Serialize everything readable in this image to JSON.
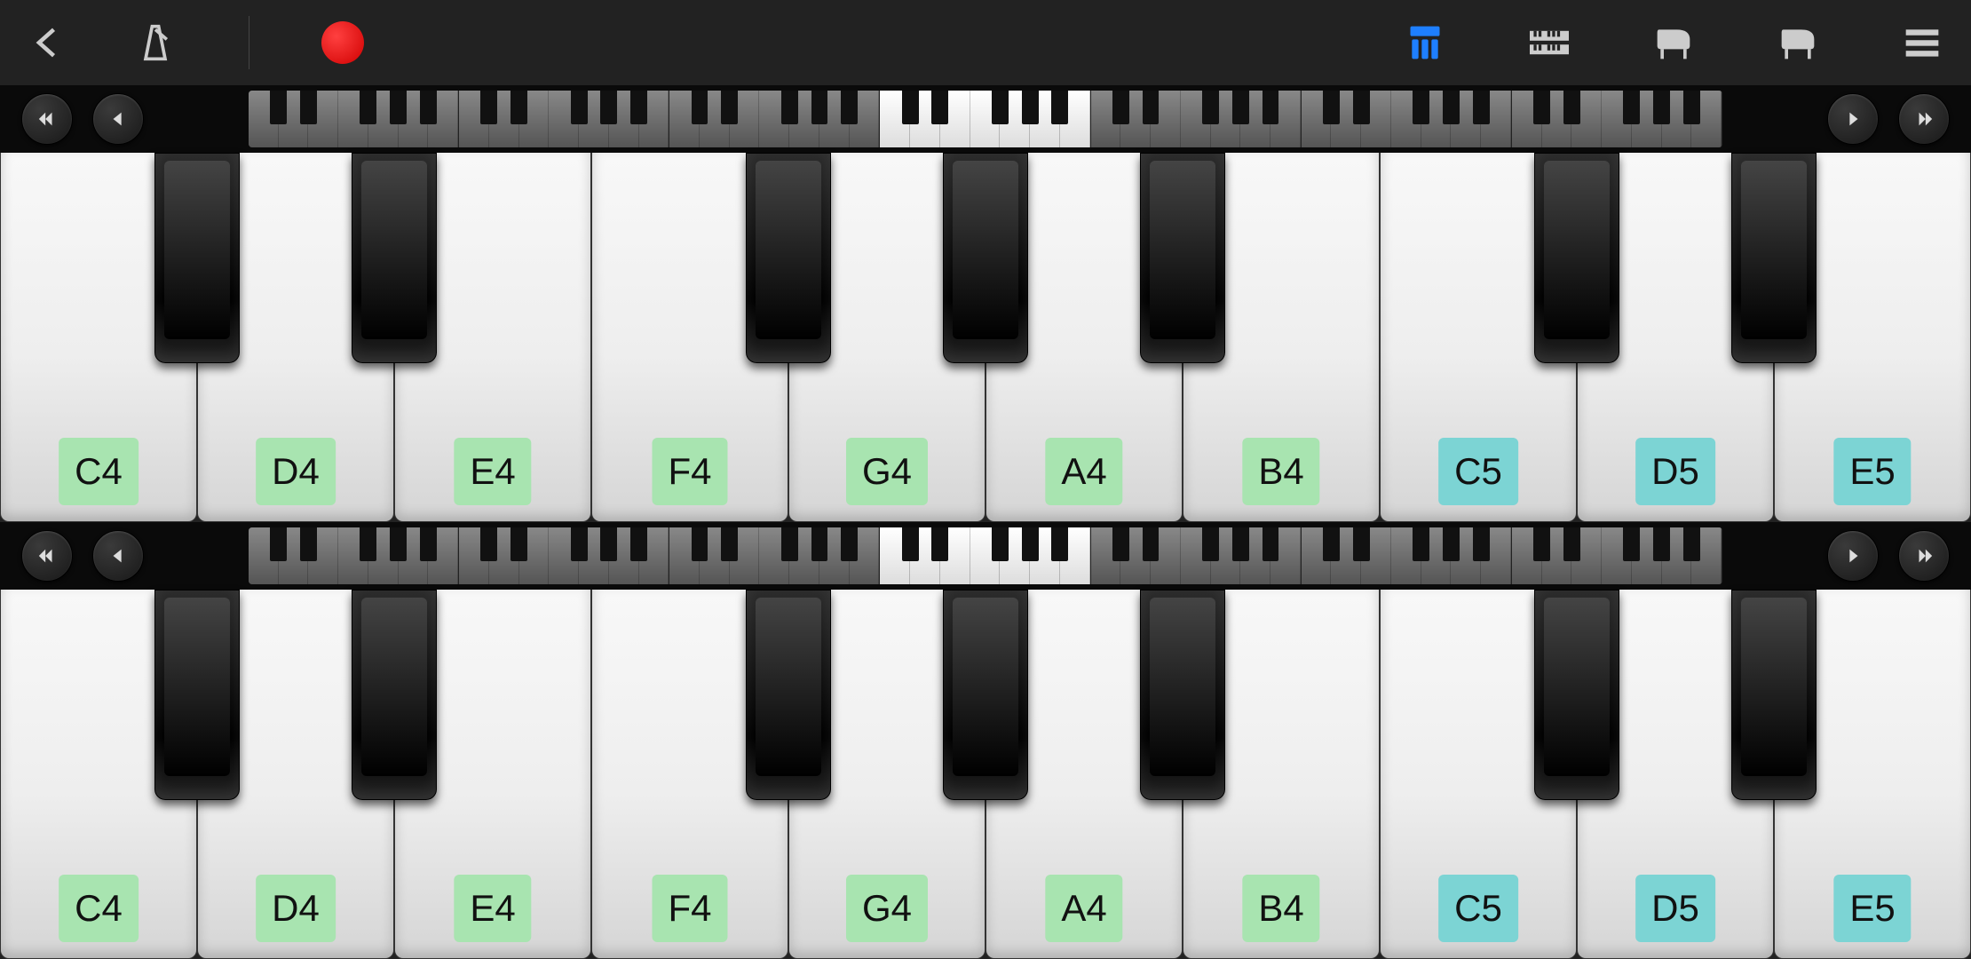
{
  "toolbar": {
    "back": "back",
    "metronome": "metronome",
    "record": "record",
    "mode_blue": "dual-mode",
    "mode_keys": "keyboard-layout",
    "piano1": "piano-1",
    "piano2": "piano-2",
    "menu": "menu"
  },
  "keyboards": [
    {
      "id": "upper",
      "white_keys": [
        {
          "note": "C4",
          "color": "green"
        },
        {
          "note": "D4",
          "color": "green"
        },
        {
          "note": "E4",
          "color": "green"
        },
        {
          "note": "F4",
          "color": "green"
        },
        {
          "note": "G4",
          "color": "green"
        },
        {
          "note": "A4",
          "color": "green"
        },
        {
          "note": "B4",
          "color": "green"
        },
        {
          "note": "C5",
          "color": "cyan"
        },
        {
          "note": "D5",
          "color": "cyan"
        },
        {
          "note": "E5",
          "color": "cyan"
        }
      ],
      "black_keys": [
        "C#4",
        "D#4",
        "F#4",
        "G#4",
        "A#4",
        "C#5",
        "D#5"
      ]
    },
    {
      "id": "lower",
      "white_keys": [
        {
          "note": "C4",
          "color": "green"
        },
        {
          "note": "D4",
          "color": "green"
        },
        {
          "note": "E4",
          "color": "green"
        },
        {
          "note": "F4",
          "color": "green"
        },
        {
          "note": "G4",
          "color": "green"
        },
        {
          "note": "A4",
          "color": "green"
        },
        {
          "note": "B4",
          "color": "green"
        },
        {
          "note": "C5",
          "color": "cyan"
        },
        {
          "note": "D5",
          "color": "cyan"
        },
        {
          "note": "E5",
          "color": "cyan"
        }
      ],
      "black_keys": [
        "C#4",
        "D#4",
        "F#4",
        "G#4",
        "A#4",
        "C#5",
        "D#5"
      ]
    }
  ],
  "mini_overview": {
    "total_octaves": 7,
    "highlighted_start_fraction": 0.43,
    "highlighted_width_fraction": 0.2
  },
  "nav": {
    "fast_back": "fast-back",
    "back": "step-back",
    "forward": "step-forward",
    "fast_forward": "fast-forward"
  }
}
